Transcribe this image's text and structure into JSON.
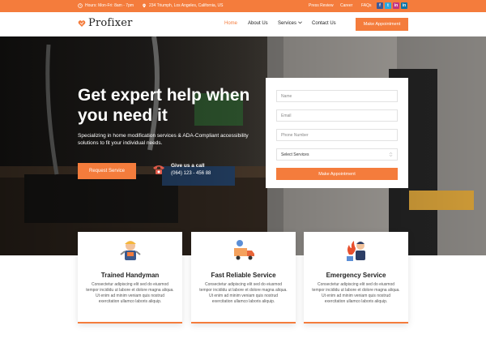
{
  "topbar": {
    "hours": "Hours: Mon-Fri: 8am - 7pm",
    "address": "234 Triumph, Los Angeles, California, US",
    "links": [
      "Press Review",
      "Career",
      "FAQs"
    ],
    "social": [
      "f",
      "t",
      "in",
      "in"
    ]
  },
  "nav": {
    "logo": "Profixer",
    "items": [
      "Home",
      "About Us",
      "Services",
      "Contact Us"
    ],
    "cta": "Make Appointment"
  },
  "hero": {
    "title": "Get expert help when you need it",
    "text": "Specializing in home modification services & ADA-Compliant accessibility solutions to fit your individual needs.",
    "button": "Request Service",
    "call_title": "Give us a call",
    "call_number": "(064) 123 - 456 88"
  },
  "form": {
    "name_placeholder": "Name",
    "email_placeholder": "Email",
    "phone_placeholder": "Phone Number",
    "service_select": "Select Services",
    "submit": "Make Appointment"
  },
  "cards": [
    {
      "title": "Trained Handyman",
      "text": "Consectetur adipiscing elit sed do eiusmod tempor incididu ut labore et dolore magna aliqua. Ut enim ad minim veniam quis nostrud exercitation ullamco laboris aliquip."
    },
    {
      "title": "Fast Reliable Service",
      "text": "Consectetur adipiscing elit sed do eiusmod tempor incididu ut labore et dolore magna aliqua. Ut enim ad minim veniam quis nostrud exercitation ullamco laboris aliquip."
    },
    {
      "title": "Emergency Service",
      "text": "Consectetur adipiscing elit sed do eiusmod tempor incididu ut labore et dolore magna aliqua. Ut enim ad minim veniam quis nostrud exercitation ullamco laboris aliquip."
    }
  ],
  "colors": {
    "accent": "#f47c3c",
    "dark": "#222222"
  }
}
